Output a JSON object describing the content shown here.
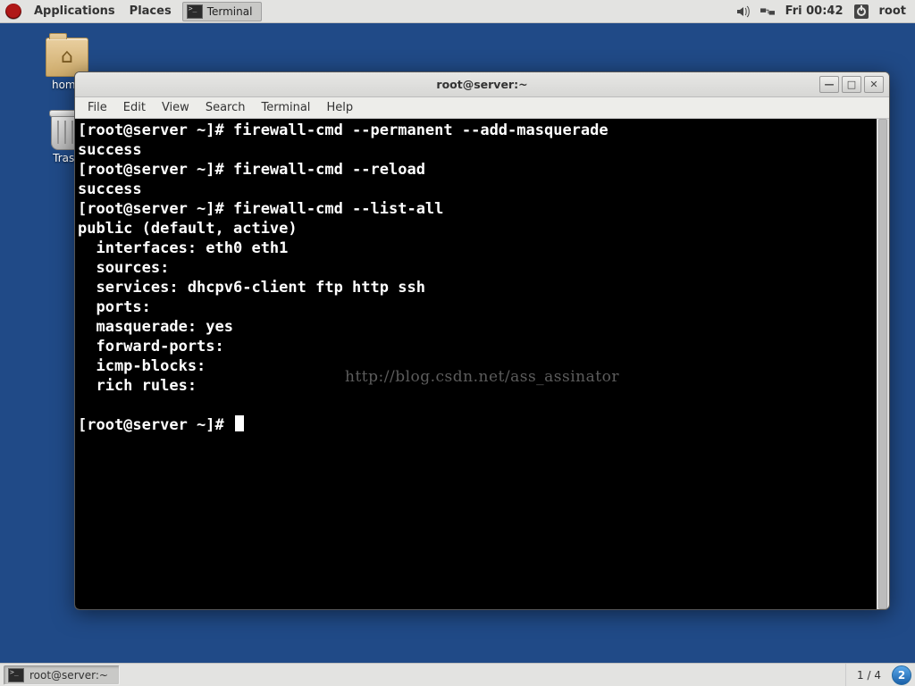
{
  "top_panel": {
    "applications": "Applications",
    "places": "Places",
    "task_label": "Terminal",
    "clock": "Fri 00:42",
    "user": "root"
  },
  "desktop": {
    "home_label": "home",
    "trash_label": "Trash"
  },
  "terminal_window": {
    "title": "root@server:~",
    "menu": [
      "File",
      "Edit",
      "View",
      "Search",
      "Terminal",
      "Help"
    ],
    "min_tip": "—",
    "max_tip": "□",
    "close_tip": "✕",
    "prompt": "[root@server ~]# ",
    "lines": [
      "[root@server ~]# firewall-cmd --permanent --add-masquerade",
      "success",
      "[root@server ~]# firewall-cmd --reload",
      "success",
      "[root@server ~]# firewall-cmd --list-all",
      "public (default, active)",
      "  interfaces: eth0 eth1",
      "  sources: ",
      "  services: dhcpv6-client ftp http ssh",
      "  ports: ",
      "  masquerade: yes",
      "  forward-ports: ",
      "  icmp-blocks: ",
      "  rich rules: ",
      "\t"
    ],
    "watermark": "http://blog.csdn.net/ass_assinator"
  },
  "bottom_panel": {
    "task_label": "root@server:~",
    "workspace": "1 / 4",
    "ws_badge": "2"
  }
}
